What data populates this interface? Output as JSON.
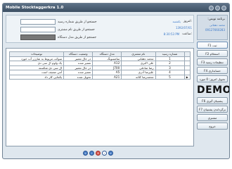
{
  "window": {
    "title": "Mobile Stocktaggerkra 1.0"
  },
  "search": {
    "by_receipt_label": "جستجو از طریق شماره رسید",
    "by_customer_label": "جستجو از طریق نام مشتری",
    "by_device_label": "جستجو از طریق مدل دستگاه"
  },
  "info": {
    "today_label": "امروز:",
    "today_value": "یکشنبه",
    "date_value": "1392/07/01",
    "time_label": "ساعت:",
    "time_value": "8:30:53 PM"
  },
  "table": {
    "columns": [
      "شماره رسید",
      "نام مشتری",
      "مدل دستگاه",
      "وضعیت دستگاه",
      "توضیحات"
    ],
    "rows": [
      {
        "id": "1",
        "customer": "محمد دهقانی",
        "model": "سامسونگ",
        "status": "در حال تعمیر",
        "note": "سوکت مربوط به شارژر آب خورد"
      },
      {
        "id": "2",
        "customer": "علی اکبری",
        "model": "A12",
        "status": "تعمیر شده",
        "note": "یک ولوم ال سی دی"
      },
      {
        "id": "3",
        "customer": "رضا صادقی",
        "model": "J700",
        "status": "در حال تعمیر",
        "note": "ال سی دی شکسته"
      },
      {
        "id": "4",
        "customer": "علیرضا آذری",
        "model": "A5",
        "status": "تعمیر شده",
        "note": "آنتن ضعیف است"
      },
      {
        "id": "5",
        "customer": "محمدرضا کلانه",
        "model": "A21",
        "status": "تحویل شده",
        "note": "یکجایی کار داد"
      }
    ],
    "selected_marker": "▶"
  },
  "pager": {
    "first": "«",
    "prev": "‹",
    "close": "×",
    "next": "›",
    "last": "»"
  },
  "sidebar": {
    "user_title": "برنامه نویس:",
    "user_name": "محمد دهقانی",
    "user_phone": "09127660283",
    "menu": [
      {
        "label": "ثبت",
        "key": "F1"
      },
      {
        "label": "استعلام",
        "key": "F2"
      },
      {
        "label": "تنظیمات رسید",
        "key": "F3"
      },
      {
        "label": "حسابداری",
        "key": "F4"
      },
      {
        "label": "تحویل امروز: 0 مورد",
        "key": ""
      }
    ],
    "demo": "DEMO",
    "menu2": [
      {
        "label": "پشتیبان گیری",
        "key": "F6"
      },
      {
        "label": "برگرداندن پشتیبان",
        "key": "F7"
      },
      {
        "label": "مشتری",
        "key": ""
      },
      {
        "label": "خروج",
        "key": ""
      }
    ]
  }
}
